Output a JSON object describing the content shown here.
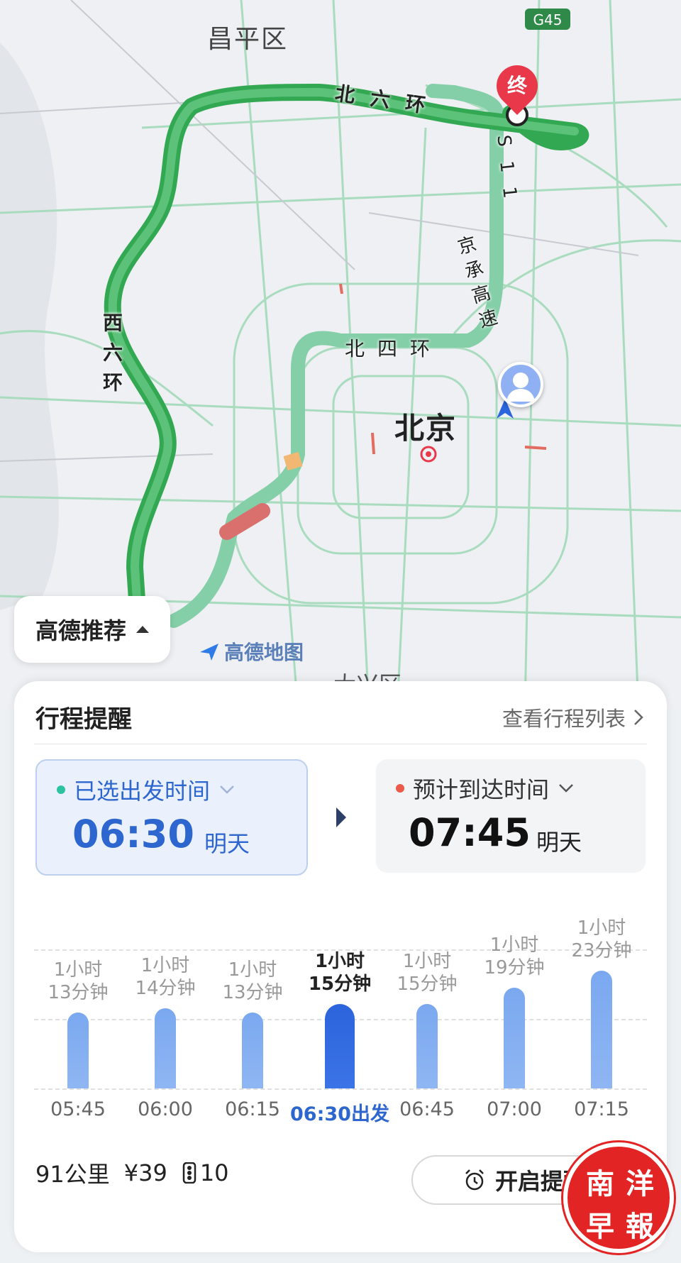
{
  "map": {
    "highway_badge": "G45",
    "district_label": "昌平区",
    "city_label": "北京",
    "road_north_sixth_ring": "北六环",
    "road_west_sixth_ring": "西六环",
    "road_north_fourth_ring": "北四环",
    "road_s11": "S11",
    "road_jingcheng": "京承高速",
    "end_marker": "终",
    "district_partial": "大兴区",
    "route_preference_label": "高德推荐",
    "brand_logo_text": "高德地图",
    "colors": {
      "route_main": "#33a852",
      "route_alt": "#7dcca0",
      "congestion": "#d9706d",
      "slow": "#f2b773"
    }
  },
  "panel": {
    "title": "行程提醒",
    "view_list_link": "查看行程列表",
    "depart": {
      "label": "已选出发时间",
      "time": "06:30",
      "day": "明天",
      "dot_color": "#2dc3a1"
    },
    "arrive": {
      "label": "预计到达时间",
      "time": "07:45",
      "day": "明天",
      "dot_color": "#ec5a4a"
    },
    "chart_data": {
      "type": "bar",
      "categories": [
        "05:45",
        "06:00",
        "06:15",
        "06:30出发",
        "06:45",
        "07:00",
        "07:15"
      ],
      "values": [
        73,
        74,
        73,
        75,
        75,
        79,
        83
      ],
      "duration_labels": [
        [
          "1小时",
          "13分钟"
        ],
        [
          "1小时",
          "14分钟"
        ],
        [
          "1小时",
          "13分钟"
        ],
        [
          "1小时",
          "15分钟"
        ],
        [
          "1小时",
          "15分钟"
        ],
        [
          "1小时",
          "19分钟"
        ],
        [
          "1小时",
          "23分钟"
        ]
      ],
      "selected_index": 3,
      "colors": {
        "bar": "#7aa8ef",
        "selected": "#2b64dc"
      }
    },
    "summary": {
      "distance": "91公里",
      "toll": "¥39",
      "lights": "10"
    },
    "remind_button": "开启提醒"
  },
  "watermark": {
    "chars": [
      "南",
      "洋",
      "早",
      "報"
    ]
  }
}
